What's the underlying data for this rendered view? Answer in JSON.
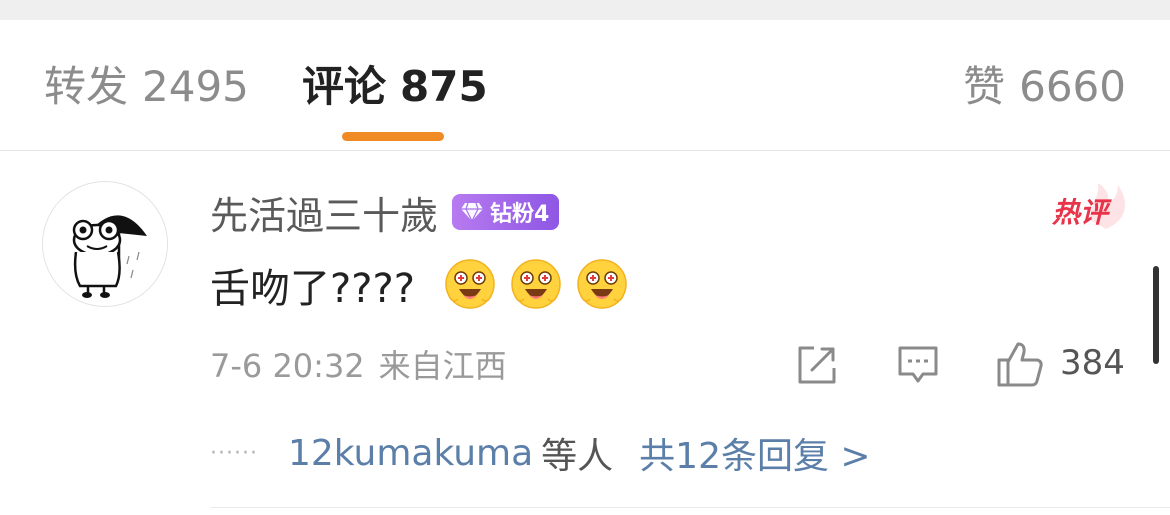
{
  "tabs": {
    "forward": {
      "label": "转发",
      "count": "2495"
    },
    "comments": {
      "label": "评论",
      "count": "875"
    },
    "likes": {
      "label": "赞",
      "count": "6660"
    }
  },
  "colors": {
    "accent": "#f08a24",
    "link": "#5b7fa8",
    "hot": "#e8344a",
    "badge": "#9b62ea"
  },
  "comment": {
    "username": "先活過三十歲",
    "fan_badge": "钻粉4",
    "hot_badge": "热评",
    "text": "舌吻了????",
    "emojis": [
      "drooling-face",
      "drooling-face",
      "drooling-face"
    ],
    "time": "7-6 20:32",
    "location": "来自江西",
    "like_count": "384",
    "replies": {
      "dots": "······",
      "user": "12kumakuma",
      "etc": "等人",
      "total": "共12条回复 >"
    }
  }
}
